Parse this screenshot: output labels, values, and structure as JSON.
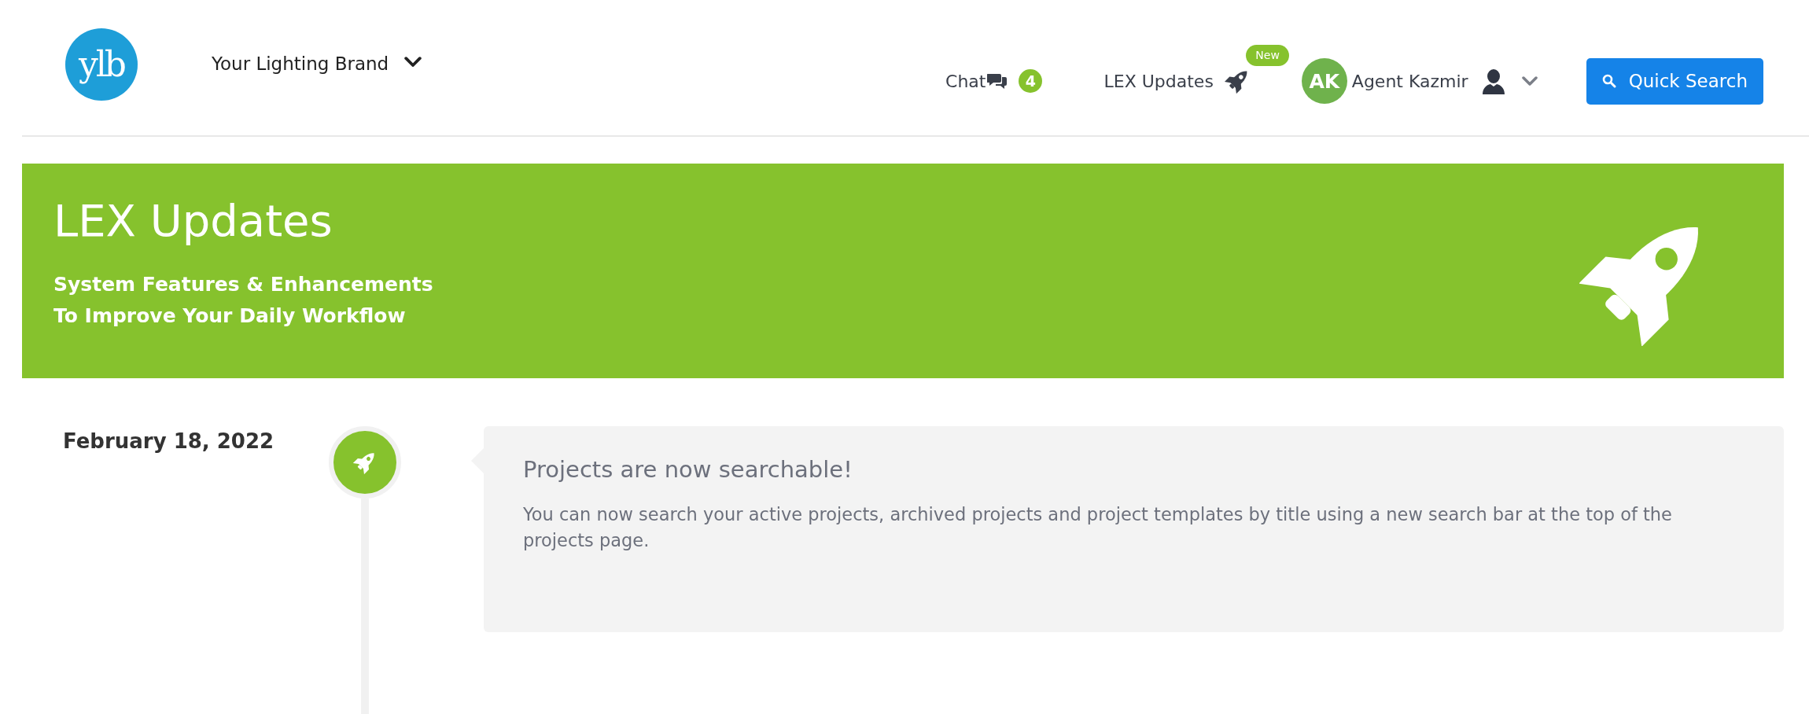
{
  "header": {
    "logo": "ylb",
    "brand": "Your Lighting Brand",
    "nav": [
      {
        "kind": "chat",
        "label": "Chat",
        "count": "4"
      },
      {
        "kind": "updates",
        "label": "LEX Updates",
        "badge": "New"
      }
    ],
    "user": {
      "initials": "AK",
      "name": "Agent Kazmir"
    },
    "search_button": "Quick Search"
  },
  "banner": {
    "title": "LEX Updates",
    "subtitle_lines": [
      "System Features & Enhancements",
      "To Improve Your Daily Workflow"
    ]
  },
  "timeline": [
    {
      "date": "February 18, 2022",
      "title": "Projects are now searchable!",
      "body": "You can now search your active projects, archived projects and project templates by title using a new search bar at the top of the projects page."
    }
  ]
}
